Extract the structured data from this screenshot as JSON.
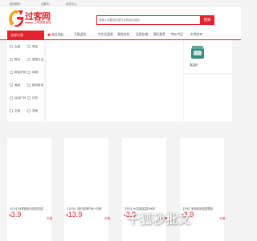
{
  "topbar": {
    "links": [
      "返回首页",
      "加载中...",
      "会员中心"
    ]
  },
  "logo": {
    "title": "过客网",
    "subtitle": "让购物更省钱"
  },
  "search": {
    "placeholder": "请输入您要找的宝贝名称或店铺名",
    "button_label": "搜索"
  },
  "nav": {
    "category_label": "全部分类",
    "items": [
      "首页导航",
      "天猫返利",
      "京东优惠券",
      "潮流女装",
      "品牌店铺",
      "精品推荐",
      "特价专区",
      "本周热卖"
    ]
  },
  "categories": [
    [
      "女装",
      "男装"
    ],
    [
      "鞋包",
      "居家生活"
    ],
    [
      "美妆护肤",
      "母婴"
    ],
    [
      "美食",
      "数码家电"
    ],
    [
      "运动户外",
      "内衣"
    ],
    [
      "文具",
      "其他"
    ]
  ],
  "hot": {
    "item_label": "保温杯"
  },
  "products": [
    {
      "title": "【0元】秋季新款长裙连衣裙",
      "price": "3.9",
      "tag": "天猫"
    },
    {
      "title": "【10元】简约百搭时尚小白鞋",
      "price": "13.9",
      "tag": "天猫"
    },
    {
      "title": "【5元】大容量保温杯水杯",
      "price": "3.9",
      "tag": "天猫"
    },
    {
      "title": "【3元】家用收纳盒整理盒",
      "price": "3.9",
      "tag": "天猫"
    }
  ],
  "watermark": "千狐秒批文",
  "colors": {
    "brand": "#e5232f",
    "background": "#f3f3f3"
  }
}
